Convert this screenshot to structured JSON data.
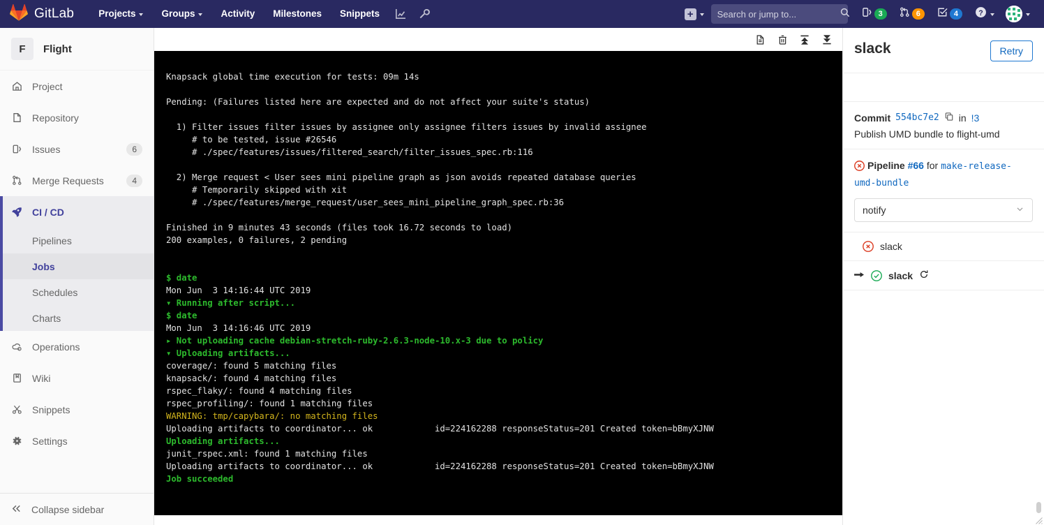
{
  "navbar": {
    "brand": "GitLab",
    "brand_icon": "gitlab-logo-icon",
    "links": [
      {
        "label": "Projects",
        "has_caret": true,
        "name": "nav-projects"
      },
      {
        "label": "Groups",
        "has_caret": true,
        "name": "nav-groups"
      },
      {
        "label": "Activity",
        "has_caret": false,
        "name": "nav-activity"
      },
      {
        "label": "Milestones",
        "has_caret": false,
        "name": "nav-milestones"
      },
      {
        "label": "Snippets",
        "has_caret": false,
        "name": "nav-snippets"
      }
    ],
    "icon_buttons": [
      {
        "name": "analytics-chart-icon"
      },
      {
        "name": "wrench-icon"
      }
    ],
    "plus_label": "+",
    "search": {
      "placeholder": "Search or jump to...",
      "value": "",
      "icon": "search-icon"
    },
    "counters": [
      {
        "name": "issues-counter",
        "icon": "issues-icon",
        "count": "3",
        "color": "#1aaa55"
      },
      {
        "name": "merge-requests-counter",
        "icon": "merge-request-icon",
        "count": "6",
        "color": "#fc9403"
      },
      {
        "name": "todos-counter",
        "icon": "todo-check-icon",
        "count": "4",
        "color": "#1f78d1"
      }
    ],
    "help_icon": "help-question-icon",
    "avatar_icon": "user-avatar"
  },
  "sidebar": {
    "project": {
      "initial": "F",
      "name": "Flight"
    },
    "items": [
      {
        "label": "Project",
        "icon": "home-icon",
        "count": null,
        "name": "sidebar-item-project"
      },
      {
        "label": "Repository",
        "icon": "document-icon",
        "count": null,
        "name": "sidebar-item-repository"
      },
      {
        "label": "Issues",
        "icon": "issues-icon",
        "count": "6",
        "name": "sidebar-item-issues"
      },
      {
        "label": "Merge Requests",
        "icon": "merge-request-icon",
        "count": "4",
        "name": "sidebar-item-merge-requests"
      }
    ],
    "active_item": {
      "label": "CI / CD",
      "icon": "rocket-icon",
      "name": "sidebar-item-cicd"
    },
    "sub_items": [
      {
        "label": "Pipelines",
        "current": false,
        "name": "sidebar-subitem-pipelines"
      },
      {
        "label": "Jobs",
        "current": true,
        "name": "sidebar-subitem-jobs"
      },
      {
        "label": "Schedules",
        "current": false,
        "name": "sidebar-subitem-schedules"
      },
      {
        "label": "Charts",
        "current": false,
        "name": "sidebar-subitem-charts"
      }
    ],
    "items_after": [
      {
        "label": "Operations",
        "icon": "operations-cloud-icon",
        "count": null,
        "name": "sidebar-item-operations"
      },
      {
        "label": "Wiki",
        "icon": "book-icon",
        "count": null,
        "name": "sidebar-item-wiki"
      },
      {
        "label": "Snippets",
        "icon": "scissors-icon",
        "count": null,
        "name": "sidebar-item-snippets"
      },
      {
        "label": "Settings",
        "icon": "gear-icon",
        "count": null,
        "name": "sidebar-item-settings"
      }
    ],
    "collapse": {
      "label": "Collapse sidebar",
      "icon": "double-chevron-left-icon"
    }
  },
  "log_toolbar": [
    {
      "name": "raw-log-icon"
    },
    {
      "name": "erase-log-trash-icon"
    },
    {
      "name": "scroll-to-top-icon"
    },
    {
      "name": "scroll-to-bottom-icon"
    }
  ],
  "log": {
    "lines": [
      {
        "text": "Knapsack global time execution for tests: 09m 14s",
        "style": "plain"
      },
      {
        "text": "",
        "style": "blank"
      },
      {
        "text": "Pending: (Failures listed here are expected and do not affect your suite's status)",
        "style": "plain"
      },
      {
        "text": "",
        "style": "blank"
      },
      {
        "text": "  1) Filter issues filter issues by assignee only assignee filters issues by invalid assignee",
        "style": "plain"
      },
      {
        "text": "     # to be tested, issue #26546",
        "style": "plain"
      },
      {
        "text": "     # ./spec/features/issues/filtered_search/filter_issues_spec.rb:116",
        "style": "plain"
      },
      {
        "text": "",
        "style": "blank"
      },
      {
        "text": "  2) Merge request < User sees mini pipeline graph as json avoids repeated database queries",
        "style": "plain"
      },
      {
        "text": "     # Temporarily skipped with xit",
        "style": "plain"
      },
      {
        "text": "     # ./spec/features/merge_request/user_sees_mini_pipeline_graph_spec.rb:36",
        "style": "plain"
      },
      {
        "text": "",
        "style": "blank"
      },
      {
        "text": "Finished in 9 minutes 43 seconds (files took 16.72 seconds to load)",
        "style": "plain"
      },
      {
        "text": "200 examples, 0 failures, 2 pending",
        "style": "plain"
      },
      {
        "text": "",
        "style": "blank"
      },
      {
        "text": "",
        "style": "blank"
      },
      {
        "text": "$ date",
        "style": "green"
      },
      {
        "text": "Mon Jun  3 14:16:44 UTC 2019",
        "style": "plain"
      },
      {
        "text": "▾ Running after script...",
        "style": "green"
      },
      {
        "text": "$ date",
        "style": "green"
      },
      {
        "text": "Mon Jun  3 14:16:46 UTC 2019",
        "style": "plain"
      },
      {
        "text": "▸ Not uploading cache debian-stretch-ruby-2.6.3-node-10.x-3 due to policy",
        "style": "green"
      },
      {
        "text": "▾ Uploading artifacts...",
        "style": "green"
      },
      {
        "text": "coverage/: found 5 matching files",
        "style": "plain"
      },
      {
        "text": "knapsack/: found 4 matching files",
        "style": "plain"
      },
      {
        "text": "rspec_flaky/: found 4 matching files",
        "style": "plain"
      },
      {
        "text": "rspec_profiling/: found 1 matching files",
        "style": "plain"
      },
      {
        "text": "WARNING: tmp/capybara/: no matching files",
        "style": "warn"
      },
      {
        "text": "Uploading artifacts to coordinator... ok            id=224162288 responseStatus=201 Created token=bBmyXJNW",
        "style": "plain"
      },
      {
        "text": "Uploading artifacts...",
        "style": "green"
      },
      {
        "text": "junit_rspec.xml: found 1 matching files",
        "style": "plain"
      },
      {
        "text": "Uploading artifacts to coordinator... ok            id=224162288 responseStatus=201 Created token=bBmyXJNW",
        "style": "plain"
      },
      {
        "text": "Job succeeded",
        "style": "green"
      }
    ]
  },
  "rightbar": {
    "title": "slack",
    "retry_label": "Retry",
    "commit": {
      "label": "Commit",
      "sha": "554bc7e2",
      "copy_icon": "copy-to-clipboard-icon",
      "in_word": "in",
      "mr_ref": "!3",
      "message": "Publish UMD bundle to flight-umd"
    },
    "pipeline": {
      "status_icon": "status-failed-icon",
      "label": "Pipeline",
      "number": "#66",
      "for_word": "for",
      "branch": "make-release-umd-bundle",
      "stage_selected": "notify",
      "stage_caret_icon": "chevron-down-icon"
    },
    "jobs": [
      {
        "name": "slack",
        "status": "failed",
        "status_icon": "status-failed-icon",
        "current": false,
        "retry_icon": null
      },
      {
        "name": "slack",
        "status": "success",
        "status_icon": "status-success-icon",
        "current": true,
        "retry_icon": "retry-arrow-icon",
        "arrow_icon": "current-job-arrow-icon"
      }
    ]
  },
  "colors": {
    "navbar_bg": "#292961",
    "accent": "#41419c",
    "link": "#1068bf",
    "success": "#1aaa55",
    "failed": "#db3b21",
    "warning": "#fc9403",
    "terminal_bg": "#000000",
    "terminal_green": "#2dba2d",
    "terminal_warn": "#d3b51d"
  }
}
